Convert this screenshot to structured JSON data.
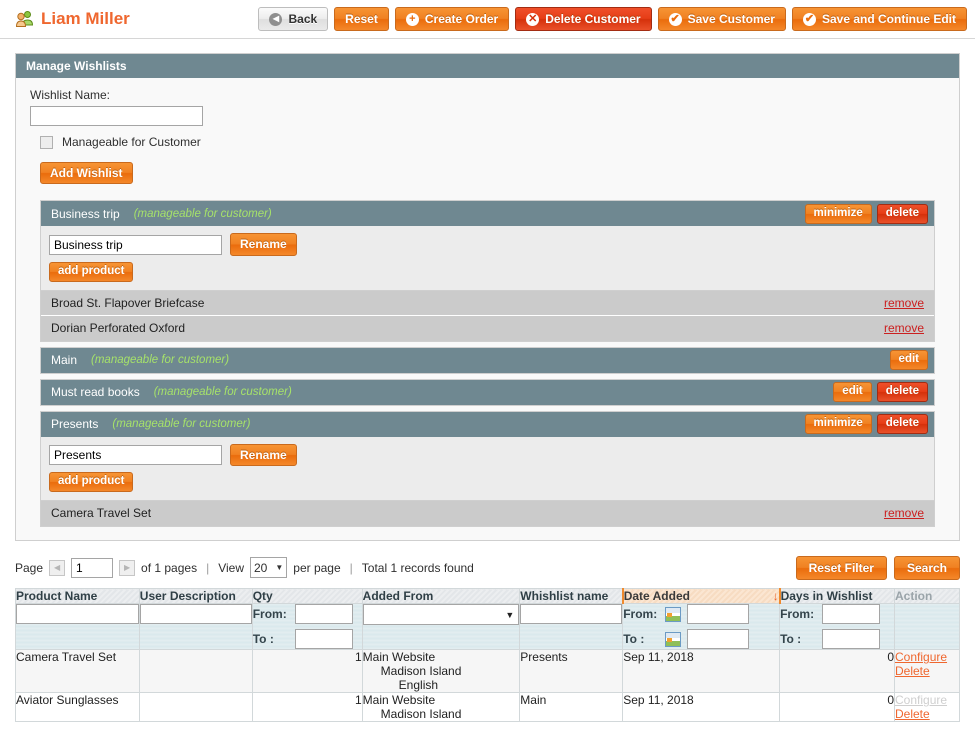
{
  "header": {
    "title": "Liam Miller",
    "icon": "customers-icon",
    "buttons": [
      {
        "label": "Back",
        "style": "grey",
        "icon": "back-arrow-icon"
      },
      {
        "label": "Reset",
        "style": "orange",
        "icon": ""
      },
      {
        "label": "Create Order",
        "style": "orange",
        "icon": "plus-circle-icon"
      },
      {
        "label": "Delete Customer",
        "style": "red",
        "icon": "x-circle-icon"
      },
      {
        "label": "Save Customer",
        "style": "orange",
        "icon": "check-circle-icon"
      },
      {
        "label": "Save and Continue Edit",
        "style": "orange",
        "icon": "check-circle-icon"
      }
    ]
  },
  "panel": {
    "title": "Manage Wishlists",
    "wishlist_name_label": "Wishlist Name:",
    "wishlist_name_value": "",
    "manageable_checkbox_label": "Manageable for Customer",
    "manageable_checked": false,
    "add_wishlist_label": "Add Wishlist"
  },
  "wishlists": [
    {
      "name": "Business trip",
      "manageable_text": "(manageable for customer)",
      "head_buttons": [
        {
          "label": "minimize",
          "style": "orange"
        },
        {
          "label": "delete",
          "style": "red"
        }
      ],
      "expanded": true,
      "rename_value": "Business trip",
      "rename_label": "Rename",
      "add_product_label": "add product",
      "items": [
        {
          "name": "Broad St. Flapover Briefcase",
          "remove_label": "remove"
        },
        {
          "name": "Dorian Perforated Oxford",
          "remove_label": "remove"
        }
      ]
    },
    {
      "name": "Main",
      "manageable_text": "(manageable for customer)",
      "head_buttons": [
        {
          "label": "edit",
          "style": "orange"
        }
      ],
      "expanded": false,
      "items": []
    },
    {
      "name": "Must read books",
      "manageable_text": "(manageable for customer)",
      "head_buttons": [
        {
          "label": "edit",
          "style": "orange"
        },
        {
          "label": "delete",
          "style": "red"
        }
      ],
      "expanded": false,
      "items": []
    },
    {
      "name": "Presents",
      "manageable_text": "(manageable for customer)",
      "head_buttons": [
        {
          "label": "minimize",
          "style": "orange"
        },
        {
          "label": "delete",
          "style": "red"
        }
      ],
      "expanded": true,
      "rename_value": "Presents",
      "rename_label": "Rename",
      "add_product_label": "add product",
      "items": [
        {
          "name": "Camera Travel Set",
          "remove_label": "remove"
        }
      ]
    }
  ],
  "grid_toolbar": {
    "page_label": "Page",
    "page_value": "1",
    "of_pages": "of 1 pages",
    "view_label": "View",
    "per_page_value": "20",
    "per_page_label": "per page",
    "total_records": "Total 1 records found",
    "reset_filter_label": "Reset Filter",
    "search_label": "Search"
  },
  "grid": {
    "columns": [
      {
        "label": "Product Name",
        "sorted": false
      },
      {
        "label": "User Description",
        "sorted": false
      },
      {
        "label": "Qty",
        "sorted": false
      },
      {
        "label": "Added From",
        "sorted": false
      },
      {
        "label": "Whishlist name",
        "sorted": false
      },
      {
        "label": "Date Added",
        "sorted": true,
        "sort_dir": "desc",
        "sort_arrow": "↓"
      },
      {
        "label": "Days in Wishlist",
        "sorted": false
      },
      {
        "label": "Action",
        "sorted": false
      }
    ],
    "filters": {
      "product_name": "",
      "user_description": "",
      "qty_from_label": "From:",
      "qty_from": "",
      "qty_to_label": "To :",
      "qty_to": "",
      "added_from": "",
      "wishlist_name": "",
      "date_from_label": "From:",
      "date_from": "",
      "date_to_label": "To :",
      "date_to": "",
      "days_from_label": "From:",
      "days_from": "",
      "days_to_label": "To :",
      "days_to": ""
    },
    "rows": [
      {
        "product_name": "Camera Travel Set",
        "user_description": "",
        "qty": "1",
        "added_from": [
          "Main Website",
          "Madison Island",
          "English"
        ],
        "wishlist_name": "Presents",
        "date_added": "Sep 11, 2018",
        "days_in_wishlist": "0",
        "actions": [
          {
            "label": "Configure",
            "disabled": false
          },
          {
            "label": "Delete",
            "disabled": false
          }
        ]
      },
      {
        "product_name": "Aviator Sunglasses",
        "user_description": "",
        "qty": "1",
        "added_from": [
          "Main Website",
          "Madison Island"
        ],
        "wishlist_name": "Main",
        "date_added": "Sep 11, 2018",
        "days_in_wishlist": "0",
        "actions": [
          {
            "label": "Configure",
            "disabled": true
          },
          {
            "label": "Delete",
            "disabled": false
          }
        ]
      }
    ]
  }
}
